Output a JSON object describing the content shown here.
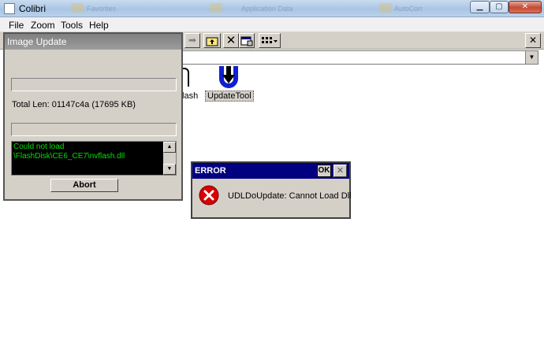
{
  "window": {
    "title": "Colibri"
  },
  "background_tabs": [
    "Favorites",
    "Application Data",
    "AutoCorr"
  ],
  "menu": [
    {
      "label": "File"
    },
    {
      "label": "Zoom"
    },
    {
      "label": "Tools"
    },
    {
      "label": "Help"
    }
  ],
  "toolbar": {
    "tools": [
      "arrow-right-icon",
      "folder-up-icon",
      "delete-icon",
      "properties-icon",
      "view-menu-icon"
    ],
    "close_label": "✕"
  },
  "files": [
    {
      "label": "flash",
      "icon": "document-icon"
    },
    {
      "label": "UpdateTool",
      "icon": "download-arrow-icon",
      "selected": true
    }
  ],
  "image_update": {
    "title": "Image Update",
    "progress1": 0,
    "progress2": 0,
    "total_len": "Total Len: 01147c4a (17695 KB)",
    "log": "Could not load\n\\FlashDisk\\CE6_CE7\\nvflash.dll",
    "abort_label": "Abort"
  },
  "error_dialog": {
    "title": "ERROR",
    "ok_label": "OK",
    "close_label": "✕",
    "message": "UDLDoUpdate: Cannot Load Dll",
    "icon": "error-icon",
    "accent": "#000080"
  }
}
